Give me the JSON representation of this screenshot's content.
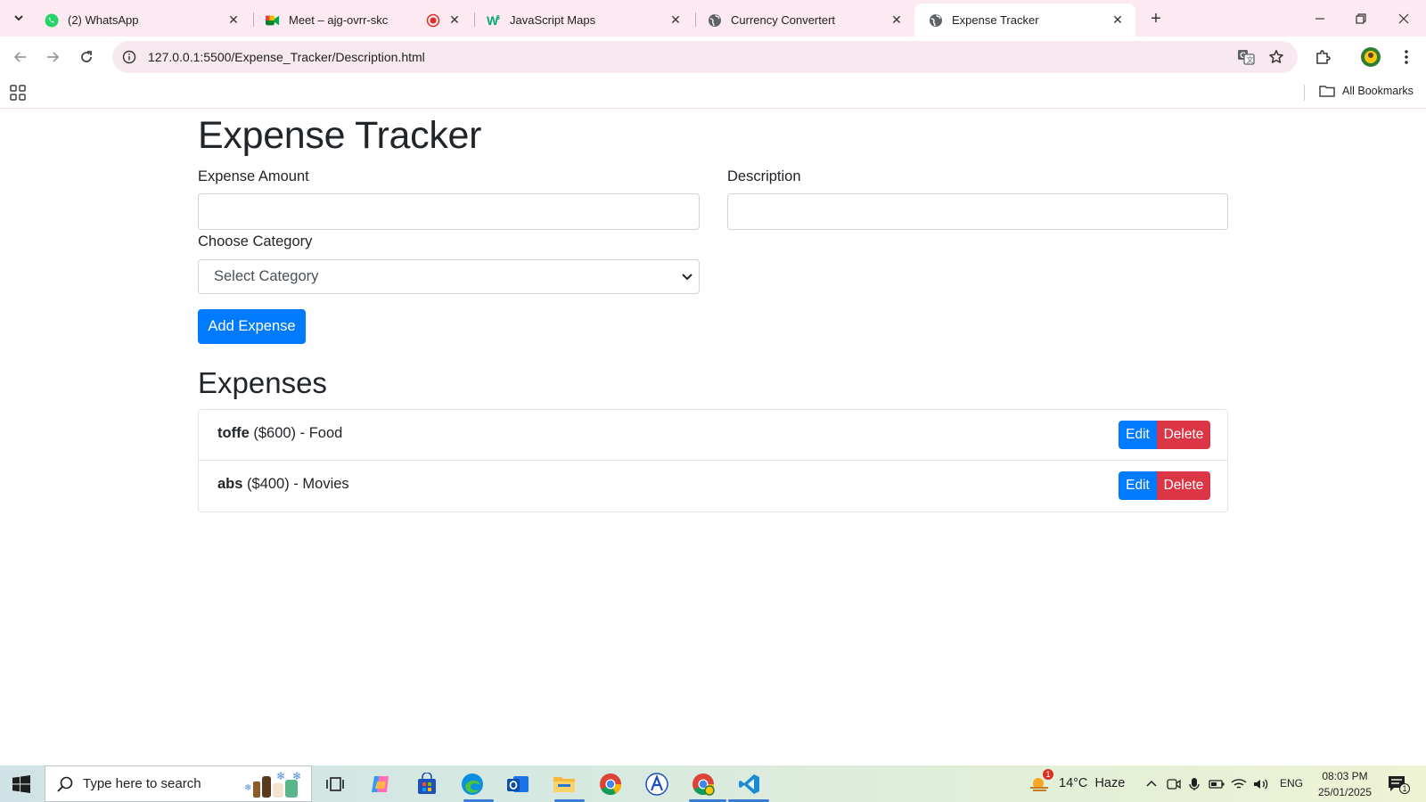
{
  "browser": {
    "tabs": [
      {
        "title": "(2) WhatsApp",
        "icon": "whatsapp-icon"
      },
      {
        "title": "Meet – ajg-ovrr-skc",
        "icon": "google-meet-icon"
      },
      {
        "title": "JavaScript Maps",
        "icon": "w3schools-icon"
      },
      {
        "title": "Currency Convertert",
        "icon": "globe-icon"
      },
      {
        "title": "Expense Tracker",
        "icon": "globe-icon",
        "active": true
      }
    ],
    "url": "127.0.0.1:5500/Expense_Tracker/Description.html",
    "all_bookmarks": "All Bookmarks"
  },
  "app": {
    "title": "Expense Tracker",
    "form": {
      "amount_label": "Expense Amount",
      "amount_value": "",
      "description_label": "Description",
      "description_value": "",
      "category_label": "Choose Category",
      "category_selected": "Select Category",
      "add_button": "Add Expense"
    },
    "expenses_heading": "Expenses",
    "expenses": [
      {
        "name": "toffe",
        "amount": "($600)",
        "category": "- Food"
      },
      {
        "name": "abs",
        "amount": "($400)",
        "category": "- Movies"
      }
    ],
    "edit_label": "Edit",
    "delete_label": "Delete"
  },
  "taskbar": {
    "search_placeholder": "Type here to search",
    "weather": "14°C  Haze",
    "weather_badge": "1",
    "language": "ENG",
    "time": "08:03 PM",
    "date": "25/01/2025",
    "notification_count": "1"
  },
  "colors": {
    "primary": "#007bff",
    "danger": "#dc3545",
    "chrome_tabstrip": "#fde9f1"
  }
}
